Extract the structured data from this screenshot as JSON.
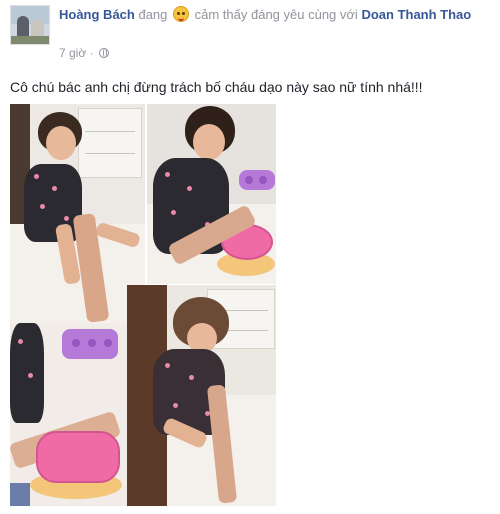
{
  "post": {
    "author_name": "Hoàng Bách",
    "status_prefix": "đang",
    "feeling_emoji": "smiling-face-emoji",
    "status_feeling": "cảm thấy đáng yêu cùng với",
    "tagged_name": "Doan Thanh Thao",
    "timestamp": "7 giờ",
    "separator": "·",
    "privacy_icon": "globe-icon",
    "text": "Cô chú bác anh chị đừng trách bố cháu dạo này sao nữ tính nhá!!!"
  },
  "photos": [
    {
      "name": "photo-1",
      "subject": "girl sitting on floor with adult hand"
    },
    {
      "name": "photo-2",
      "subject": "girl with pink toy and purple tray"
    },
    {
      "name": "photo-3",
      "subject": "adult hand and pink toy with purple tray"
    },
    {
      "name": "photo-4",
      "subject": "girl sitting looking down"
    }
  ],
  "colors": {
    "link": "#365899",
    "muted": "#90949c",
    "text": "#1d2129"
  }
}
